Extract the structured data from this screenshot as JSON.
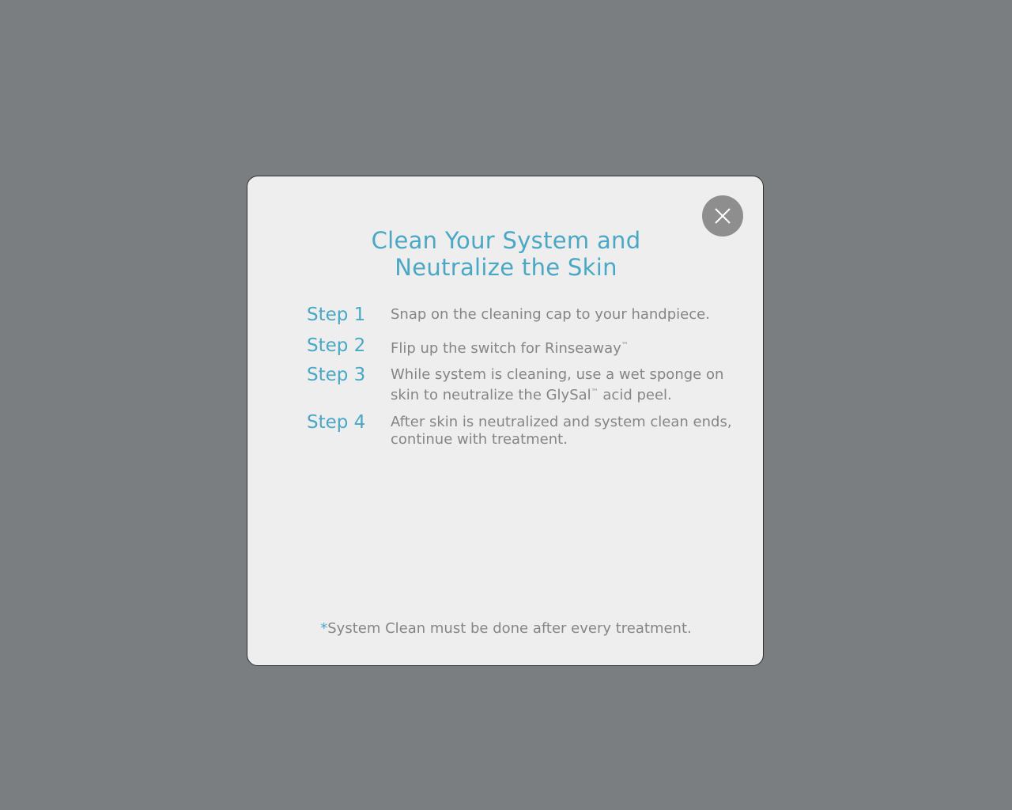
{
  "modal": {
    "title_line1": "Clean Your System and",
    "title_line2": "Neutralize the Skin",
    "close_icon": "close-icon",
    "steps": [
      {
        "label": "Step 1",
        "line1_before": "Snap on the cleaning cap to your handpiece.",
        "line1_tm": "",
        "line1_after": "",
        "line2_before": "",
        "line2_tm": "",
        "line2_after": ""
      },
      {
        "label": "Step 2",
        "line1_before": "Flip up the switch for Rinseaway",
        "line1_tm": "™",
        "line1_after": "",
        "line2_before": "",
        "line2_tm": "",
        "line2_after": ""
      },
      {
        "label": "Step 3",
        "line1_before": "While system is cleaning, use a wet sponge on",
        "line1_tm": "",
        "line1_after": "",
        "line2_before": "skin to neutralize the GlySal",
        "line2_tm": "™",
        "line2_after": " acid peel."
      },
      {
        "label": "Step 4",
        "line1_before": "After skin is neutralized and system clean ends,",
        "line1_tm": "",
        "line1_after": "",
        "line2_before": "continue with treatment.",
        "line2_tm": "",
        "line2_after": ""
      }
    ],
    "footnote_asterisk": "*",
    "footnote_text": "System Clean must be done after every treatment."
  },
  "colors": {
    "backdrop": "#7b7e81",
    "modal_bg": "#eeeeee",
    "accent": "#4aa8c4",
    "body_text": "#858585",
    "close_button": "#8e8e8e"
  }
}
